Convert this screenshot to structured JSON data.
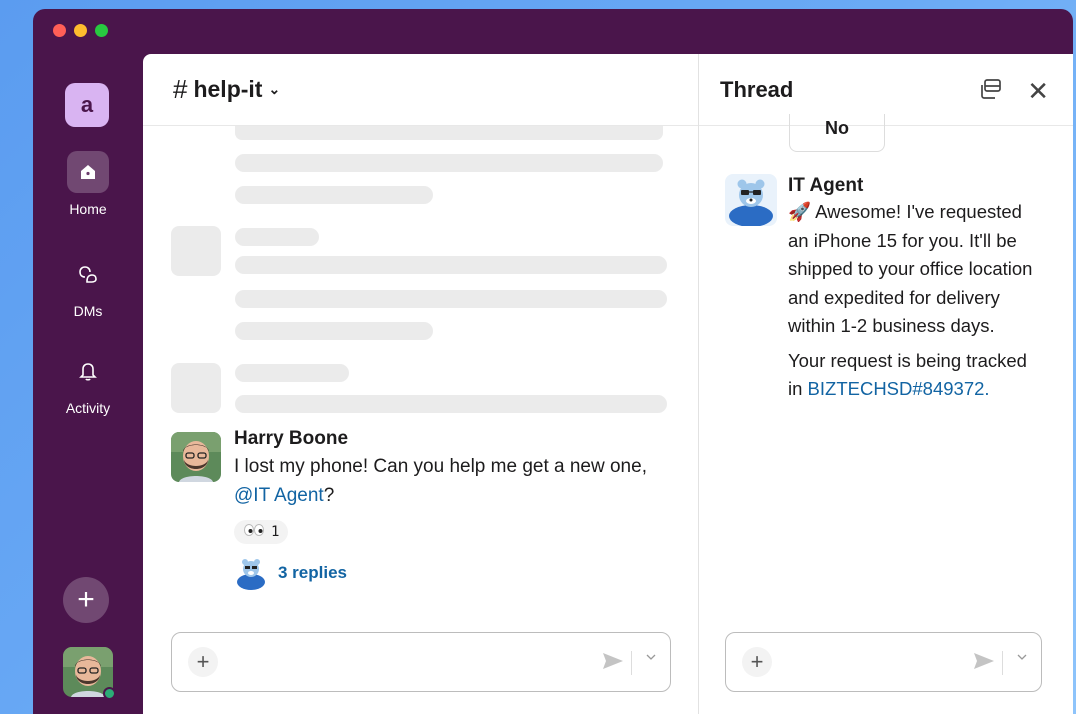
{
  "workspace": {
    "initial": "a"
  },
  "rail": {
    "items": [
      {
        "label": "Home",
        "icon": "home-icon"
      },
      {
        "label": "DMs",
        "icon": "dms-icon"
      },
      {
        "label": "Activity",
        "icon": "bell-icon"
      }
    ],
    "add_label": "+"
  },
  "channel": {
    "hash": "#",
    "name": "help-it",
    "chevron": "⌄"
  },
  "message": {
    "author": "Harry Boone",
    "text_before": "I lost my phone! Can you help me get a new one, ",
    "mention": "@IT Agent",
    "text_after": "?",
    "reaction_count": "1",
    "replies": "3 replies"
  },
  "composer": {
    "plus": "+"
  },
  "thread": {
    "title": "Thread",
    "close": "✕",
    "no_button": "No",
    "author": "IT Agent",
    "text1": "🚀 Awesome! I've requested an iPhone 15 for you.  It'll be shipped to your office location and expedited for delivery within 1-2 business days.",
    "text2": "Your request is being tracked in ",
    "ticket": "BIZTECHSD#849372."
  },
  "colors": {
    "aubergine": "#4a154b",
    "link": "#1264a3",
    "skeleton": "#ebebeb",
    "presence": "#2bac76"
  }
}
